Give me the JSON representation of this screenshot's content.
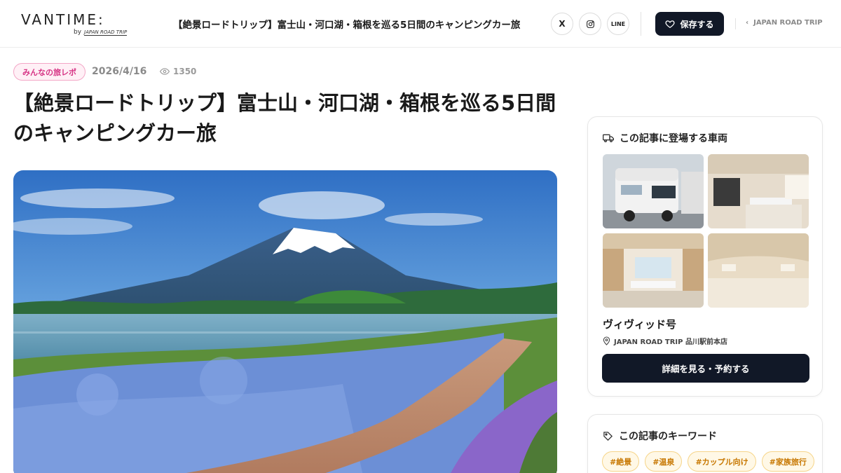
{
  "header": {
    "logo_main": "VANTIME:",
    "logo_by": "by",
    "logo_brand": "JAPAN ROAD TRIP",
    "title": "【絶景ロードトリップ】富士山・河口湖・箱根を巡る5日間のキャンピングカー旅",
    "share_x": "X",
    "share_instagram_icon": "instagram-icon",
    "share_line": "LINE",
    "save_label": "保存する",
    "back_label": "JAPAN ROAD TRIP"
  },
  "article": {
    "category": "みんなの旅レポ",
    "date": "2026/4/16",
    "views": "1350",
    "title": "【絶景ロードトリップ】富士山・河口湖・箱根を巡る5日間のキャンピングカー旅"
  },
  "vehicle_card": {
    "heading": "この記事に登場する車両",
    "name": "ヴィヴィッド号",
    "location": "JAPAN ROAD TRIP 品川駅前本店",
    "button_label": "詳細を見る・予約する"
  },
  "keyword_card": {
    "heading": "この記事のキーワード",
    "keywords": [
      "#絶景",
      "#温泉",
      "#カップル向け",
      "#家族旅行"
    ]
  },
  "colors": {
    "primary_dark": "#111827",
    "category_pink": "#d63384",
    "keyword_orange": "#c77700"
  }
}
